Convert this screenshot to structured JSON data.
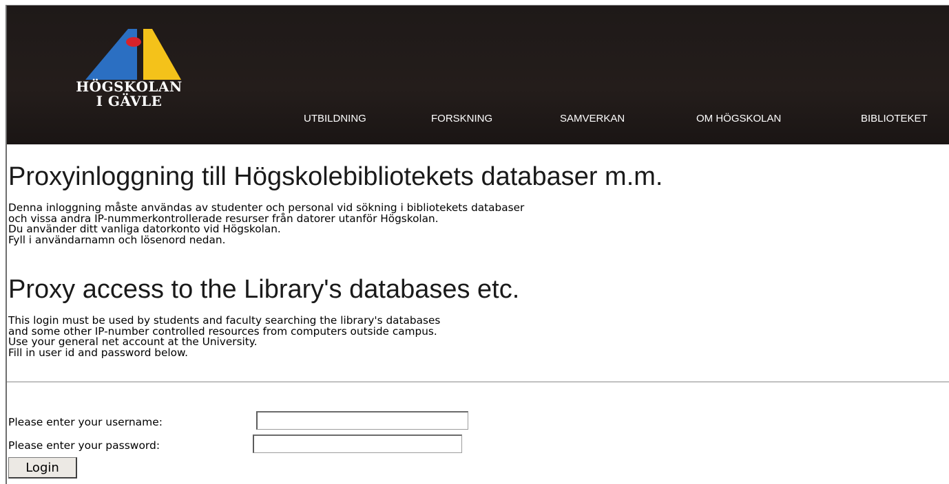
{
  "header": {
    "logo_line1": "HÖGSKOLAN",
    "logo_line2": "I GÄVLE",
    "nav": [
      {
        "label": "UTBILDNING"
      },
      {
        "label": "FORSKNING"
      },
      {
        "label": "SAMVERKAN"
      },
      {
        "label": "OM HÖGSKOLAN"
      },
      {
        "label": "BIBLIOTEKET"
      }
    ]
  },
  "swedish": {
    "heading": "Proxyinloggning till Högskolebibliotekets databaser m.m.",
    "lines": [
      "Denna inloggning måste användas av studenter och personal vid sökning i bibliotekets databaser",
      "och vissa andra IP-nummerkontrollerade resurser från datorer utanför Högskolan.",
      "Du använder ditt vanliga datorkonto vid Högskolan.",
      "Fyll i användarnamn och lösenord nedan."
    ]
  },
  "english": {
    "heading": "Proxy access to the Library's databases etc.",
    "lines": [
      "This login must be used by students and faculty searching the library's databases",
      "and some other IP-number controlled resources from computers outside campus.",
      "Use your general net account at the University.",
      "Fill in user id and password below."
    ]
  },
  "form": {
    "username_label": "Please enter your username:",
    "username_value": "",
    "password_label": "Please enter your password:",
    "password_value": "",
    "login_label": "Login"
  },
  "colors": {
    "header_bg": "#211b1a",
    "logo_blue": "#2b6fc2",
    "logo_yellow": "#f4c21a",
    "logo_red": "#d8222a"
  }
}
